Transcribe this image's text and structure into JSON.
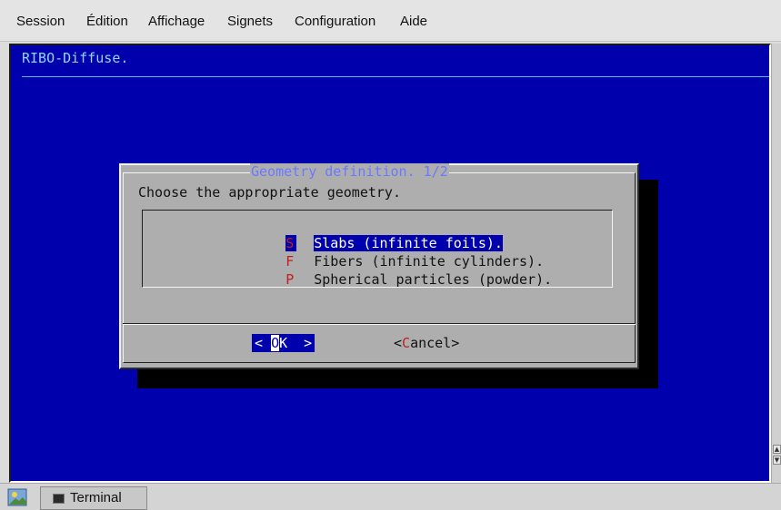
{
  "menubar": {
    "items": [
      "Session",
      "Édition",
      "Affichage",
      "Signets",
      "Configuration",
      "Aide"
    ]
  },
  "terminal": {
    "title": "RIBO-Diffuse."
  },
  "dialog": {
    "title": "Geometry definition. 1/2",
    "prompt": "Choose the appropriate geometry.",
    "items": [
      {
        "key": "S",
        "label": "Slabs (infinite foils).",
        "selected": true
      },
      {
        "key": "F",
        "label": "Fibers (infinite cylinders).",
        "selected": false
      },
      {
        "key": "P",
        "label": "Spherical particles (powder).",
        "selected": false
      }
    ],
    "ok_button": {
      "left": "< ",
      "hot": "O",
      "rest": "K",
      "right": "  >"
    },
    "cancel_button": {
      "left": "<",
      "hot": "C",
      "rest": "ancel",
      "right": ">"
    }
  },
  "taskbar": {
    "task_label": "Terminal"
  },
  "colors": {
    "terminal_bg": "#0000ad",
    "dialog_bg": "#aeaeae",
    "title_accent": "#6b79ff",
    "hotkey": "#c02020"
  }
}
